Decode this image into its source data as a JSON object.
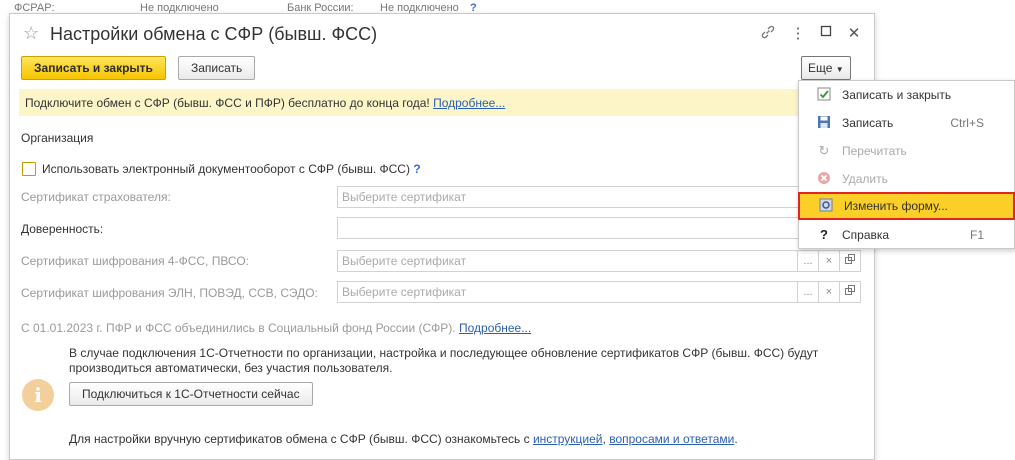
{
  "background": {
    "fragments": [
      "ФСРАР:",
      "Не подключено",
      "Банк России:",
      "Не подключено"
    ],
    "help": "?"
  },
  "window": {
    "title": "Настройки обмена с СФР (бывш. ФСС)",
    "icons": [
      "star-icon",
      "link-icon",
      "more-icon",
      "maximize-icon",
      "close-icon"
    ]
  },
  "toolbar": {
    "save_close": "Записать и закрыть",
    "save": "Записать",
    "more": "Еще"
  },
  "banner": {
    "text": "Подключите обмен с СФР (бывш. ФСС и ПФР) бесплатно до конца года!",
    "link": "Подробнее..."
  },
  "form": {
    "organization_label": "Организация",
    "use_edo_label": "Использовать электронный документооборот с СФР (бывш. ФСС)",
    "use_edo_checked": false,
    "help": "?",
    "cert_insurer_label": "Сертификат страхователя:",
    "cert_insurer_placeholder": "Выберите сертификат",
    "power_of_attorney_label": "Доверенность:",
    "power_of_attorney_value": "",
    "cert_4fss_label": "Сертификат шифрования 4-ФСС, ПВСО:",
    "cert_4fss_placeholder": "Выберите сертификат",
    "cert_eln_label": "Сертификат шифрования ЭЛН, ПОВЭД, ССВ, СЭДО:",
    "cert_eln_placeholder": "Выберите сертификат",
    "field_button_select": "...",
    "field_button_clear": "×"
  },
  "notice": {
    "merge_text": "С 01.01.2023 г. ПФР и ФСС объединились в Социальный фонд России (СФР).",
    "merge_link": "Подробнее...",
    "info_line1": "В случае подключения 1С-Отчетности по организации, настройка и последующее обновление сертификатов СФР (бывш. ФСС) будут",
    "info_line2": "производиться автоматически, без участия пользователя.",
    "connect_button": "Подключиться к 1С-Отчетности сейчас",
    "info_icon_glyph": "i",
    "manual_text": "Для настройки вручную сертификатов обмена с СФР (бывш. ФСС) ознакомьтесь с",
    "manual_link1": "инструкцией",
    "manual_sep": ",",
    "manual_link2": "вопросами и ответами",
    "manual_end": "."
  },
  "menu": {
    "items": [
      {
        "label": "Записать и закрыть",
        "shortcut": "",
        "icon": "save-close-icon",
        "enabled": true
      },
      {
        "label": "Записать",
        "shortcut": "Ctrl+S",
        "icon": "floppy-icon",
        "enabled": true
      },
      {
        "label": "Перечитать",
        "shortcut": "",
        "icon": "refresh-icon",
        "enabled": false
      },
      {
        "label": "Удалить",
        "shortcut": "",
        "icon": "delete-icon",
        "enabled": false
      },
      {
        "label": "Изменить форму...",
        "shortcut": "",
        "icon": "form-settings-icon",
        "enabled": true,
        "highlighted": true
      },
      {
        "label": "Справка",
        "shortcut": "F1",
        "icon": "help-icon",
        "enabled": true
      }
    ]
  },
  "colors": {
    "primary_button": "#f6c500",
    "banner_bg": "#fcf5c8",
    "link": "#2b5fb3",
    "highlight": "#f9cf28",
    "highlight_border": "#e22424"
  }
}
